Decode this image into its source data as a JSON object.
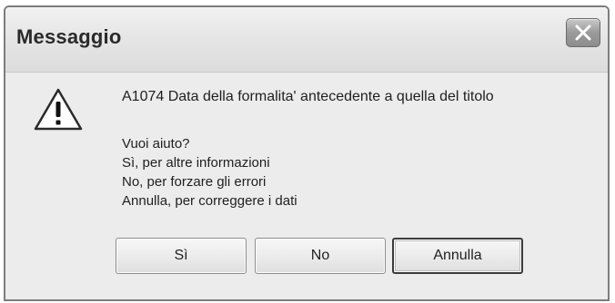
{
  "window": {
    "title": "Messaggio",
    "close_icon": "close-x"
  },
  "message": {
    "icon": "warning-triangle",
    "main": "A1074 Data della formalita' antecedente a quella del titolo",
    "lines": [
      "Vuoi aiuto?",
      "Sì, per altre informazioni",
      "No, per forzare gli errori",
      "Annulla, per correggere i dati"
    ]
  },
  "buttons": {
    "yes_label": "Sì",
    "no_label": "No",
    "cancel_label": "Annulla",
    "default": "Annulla"
  },
  "colors": {
    "dialog_background": "#ececec",
    "title_text": "#2a2a2a",
    "warning_fill": "#ffffff",
    "warning_stroke": "#2b2b2b"
  }
}
